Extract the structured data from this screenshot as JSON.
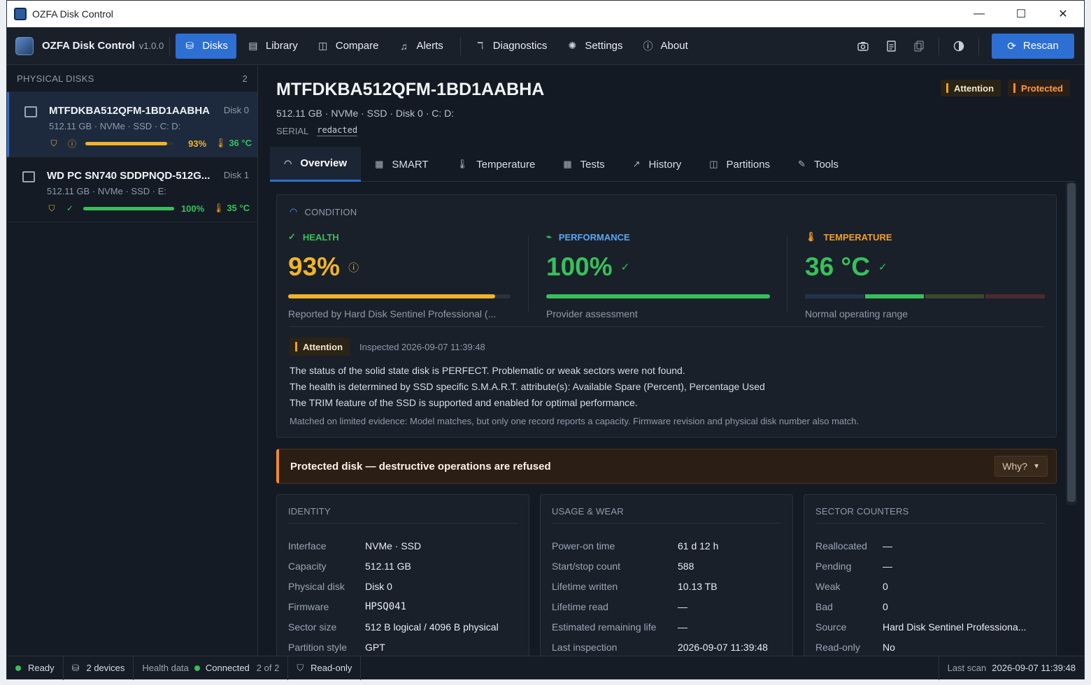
{
  "window": {
    "title": "OZFA Disk Control",
    "minimize": "—",
    "maximize": "☐",
    "close": "✕"
  },
  "nav": {
    "brand": "OZFA Disk Control",
    "version": "v1.0.0",
    "items": [
      {
        "label": "Disks",
        "icon": "database-icon",
        "glyph": "⛁"
      },
      {
        "label": "Library",
        "icon": "book-icon",
        "glyph": "▤"
      },
      {
        "label": "Compare",
        "icon": "compare-icon",
        "glyph": "◫"
      },
      {
        "label": "Alerts",
        "icon": "bell-icon",
        "glyph": "♫"
      },
      {
        "label": "Diagnostics",
        "icon": "stethoscope-icon",
        "glyph": "ℸ"
      },
      {
        "label": "Settings",
        "icon": "gear-icon",
        "glyph": "✺"
      },
      {
        "label": "About",
        "icon": "info-icon",
        "glyph": "ⓘ"
      }
    ],
    "rescan": "Rescan"
  },
  "sidebar": {
    "header": "PHYSICAL DISKS",
    "count": "2",
    "disks": [
      {
        "name": "MTFDKBA512QFM-1BD1AABHA",
        "num": "Disk 0",
        "sub": "512.11 GB  ·  NVMe  ·  SSD  ·  C: D:",
        "health": "93%",
        "health_fraction": 0.93,
        "temp": "36 °C",
        "color": "#f0b429"
      },
      {
        "name": "WD PC SN740 SDDPNQD-512G...",
        "num": "Disk 1",
        "sub": "512.11 GB  ·  NVMe  ·  SSD  ·  E:",
        "health": "100%",
        "health_fraction": 1.0,
        "temp": "35 °C",
        "color": "#37c05a"
      }
    ]
  },
  "disk": {
    "title": "MTFDKBA512QFM-1BD1AABHA",
    "subline": "512.11 GB  ·  NVMe · SSD  ·  Disk 0  ·  C: D:",
    "serial_label": "SERIAL",
    "serial_value": "redacted",
    "badge_attention": "Attention",
    "badge_protected": "Protected"
  },
  "tabs": [
    {
      "label": "Overview",
      "glyph": "◠"
    },
    {
      "label": "SMART",
      "glyph": "▦"
    },
    {
      "label": "Temperature",
      "glyph": "🌡"
    },
    {
      "label": "Tests",
      "glyph": "▦"
    },
    {
      "label": "History",
      "glyph": "↗"
    },
    {
      "label": "Partitions",
      "glyph": "◫"
    },
    {
      "label": "Tools",
      "glyph": "✎"
    }
  ],
  "condition": {
    "label": "CONDITION",
    "health": {
      "label": "HEALTH",
      "value": "93%",
      "fraction": 0.93,
      "caption": "Reported by Hard Disk Sentinel Professional (...",
      "color": "#f0b429"
    },
    "performance": {
      "label": "PERFORMANCE",
      "value": "100%",
      "fraction": 1.0,
      "caption": "Provider assessment",
      "color": "#37c05a"
    },
    "temperature": {
      "label": "TEMPERATURE",
      "value": "36 °C",
      "caption": "Normal operating range",
      "color": "#37c05a"
    },
    "attention": "Attention",
    "inspected": "Inspected 2026-09-07 11:39:48",
    "messages": [
      "The status of the solid state disk is PERFECT. Problematic or weak sectors were not found.",
      "The health is determined by SSD specific S.M.A.R.T. attribute(s):  Available Spare (Percent), Percentage Used",
      "The TRIM feature of the SSD is supported and enabled for optimal performance."
    ],
    "note": "Matched on limited evidence: Model matches, but only one record reports a capacity. Firmware revision and physical disk number also match."
  },
  "protected_bar": {
    "text": "Protected disk — destructive operations are refused",
    "why": "Why?"
  },
  "identity": {
    "label": "IDENTITY",
    "rows": [
      [
        "Interface",
        "NVMe · SSD"
      ],
      [
        "Capacity",
        "512.11 GB"
      ],
      [
        "Physical disk",
        "Disk 0"
      ],
      [
        "Firmware",
        "HPSQ041"
      ],
      [
        "Sector size",
        "512 B logical / 4096 B physical"
      ],
      [
        "Partition style",
        "GPT"
      ]
    ]
  },
  "usage": {
    "label": "USAGE & WEAR",
    "rows": [
      [
        "Power-on time",
        "61 d 12 h"
      ],
      [
        "Start/stop count",
        "588"
      ],
      [
        "Lifetime written",
        "10.13 TB"
      ],
      [
        "Lifetime read",
        "—"
      ],
      [
        "Estimated remaining life",
        "—"
      ],
      [
        "Last inspection",
        "2026-09-07 11:39:48"
      ]
    ]
  },
  "sectors": {
    "label": "SECTOR COUNTERS",
    "rows": [
      [
        "Reallocated",
        "—"
      ],
      [
        "Pending",
        "—"
      ],
      [
        "Weak",
        "0"
      ],
      [
        "Bad",
        "0"
      ],
      [
        "Source",
        "Hard Disk Sentinel Professiona..."
      ],
      [
        "Read-only",
        "No"
      ]
    ]
  },
  "status": {
    "ready": "Ready",
    "devices": "2 devices",
    "health_label": "Health data",
    "health_state": "Connected",
    "health_count": "2 of 2",
    "readonly": "Read-only",
    "last_scan_label": "Last scan",
    "last_scan": "2026-09-07 11:39:48"
  }
}
